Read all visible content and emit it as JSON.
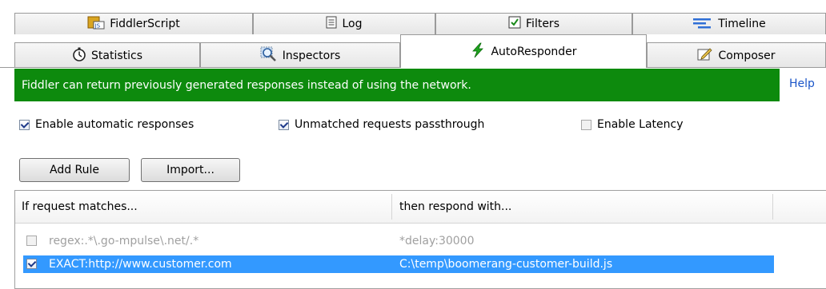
{
  "tabs_row1": [
    {
      "label": "FiddlerScript",
      "icon": "fiddlerscript-icon"
    },
    {
      "label": "Log",
      "icon": "log-icon"
    },
    {
      "label": "Filters",
      "icon": "filters-checkbox-icon"
    },
    {
      "label": "Timeline",
      "icon": "timeline-icon"
    }
  ],
  "tabs_row2": [
    {
      "label": "Statistics",
      "icon": "stopwatch-icon"
    },
    {
      "label": "Inspectors",
      "icon": "magnifier-icon"
    },
    {
      "label": "AutoResponder",
      "icon": "lightning-icon",
      "active": true
    },
    {
      "label": "Composer",
      "icon": "composer-icon"
    }
  ],
  "banner": {
    "text": "Fiddler can return previously generated responses instead of using the network.",
    "color": "#0d8a0d",
    "help": "Help"
  },
  "options": {
    "enable_auto": {
      "label": "Enable automatic responses",
      "checked": true
    },
    "passthrough": {
      "label": "Unmatched requests passthrough",
      "checked": true
    },
    "latency": {
      "label": "Enable Latency",
      "checked": false
    }
  },
  "buttons": {
    "add_rule": "Add Rule",
    "import": "Import..."
  },
  "rules": {
    "columns": [
      "If request matches...",
      "then respond with..."
    ],
    "rows": [
      {
        "match": "regex:.*\\.go-mpulse\\.net/.*",
        "respond": "*delay:30000",
        "checked": false,
        "state": "disabled"
      },
      {
        "match": "EXACT:http://www.customer.com",
        "respond": "C:\\temp\\boomerang-customer-build.js",
        "checked": true,
        "state": "selected"
      }
    ],
    "selection_color": "#3399ff"
  }
}
